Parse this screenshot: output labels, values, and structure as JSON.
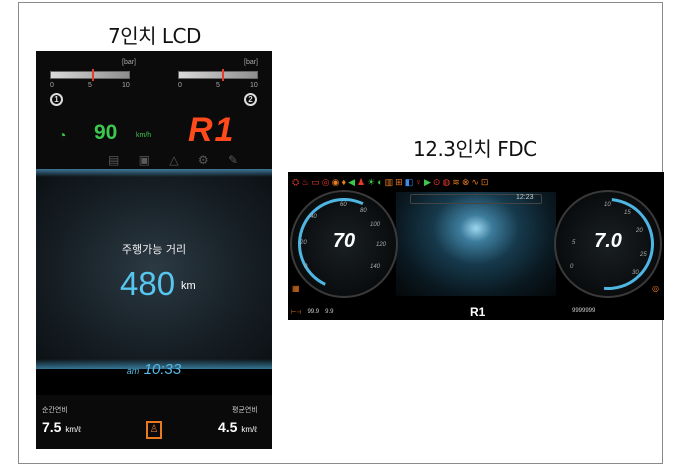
{
  "captions": {
    "lcd": "7인치 LCD",
    "fdc": "12.3인치 FDC"
  },
  "lcd": {
    "gauge_left": {
      "unit": "[bar]",
      "ticks": [
        "0",
        "5",
        "10"
      ],
      "badge": "1"
    },
    "gauge_right": {
      "unit": "[bar]",
      "ticks": [
        "0",
        "5",
        "10"
      ],
      "badge": "2"
    },
    "speed_value": "90",
    "speed_unit": "km/h",
    "gear": "R1",
    "range_label": "주행가능 거리",
    "range_value": "480",
    "range_unit": "km",
    "time_am": "am",
    "time": "10:33",
    "instant_label": "순간연비",
    "instant_value": "7.5",
    "instant_unit": "km/ℓ",
    "avg_label": "평균연비",
    "avg_value": "4.5",
    "avg_unit": "km/ℓ",
    "colors": {
      "speed": "#3cc84e",
      "gear": "#ff4a1c",
      "range": "#56c6ee",
      "warning": "#e87a20"
    }
  },
  "fdc": {
    "clock": "12:23",
    "left_dial": {
      "value": "70",
      "ticks": [
        "60",
        "80",
        "100",
        "40",
        "120",
        "20",
        "140",
        "0"
      ]
    },
    "right_dial": {
      "value": "7.0",
      "ticks": [
        "10",
        "15",
        "20",
        "5",
        "25",
        "0",
        "30"
      ]
    },
    "gear": "R1",
    "trip_a": "99.9",
    "trip_b": "9.9",
    "odometer": "9999999",
    "icons": [
      "engine-icon",
      "oil-icon",
      "battery-icon",
      "brake-icon",
      "abs-icon",
      "seatbelt-icon",
      "light-icon",
      "fog-icon",
      "temp-icon",
      "fuel-icon",
      "door-icon",
      "airbag-icon"
    ]
  }
}
